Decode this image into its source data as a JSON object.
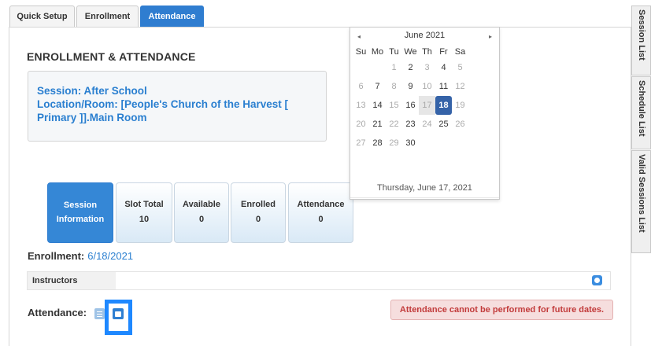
{
  "tabs": {
    "quick_setup": "Quick Setup",
    "enrollment": "Enrollment",
    "attendance": "Attendance"
  },
  "section_title": "ENROLLMENT & ATTENDANCE",
  "session": {
    "line1": "Session: After School",
    "line2": "Location/Room: [People's Church of the Harvest [",
    "line3": "Primary ]].Main Room"
  },
  "cards": {
    "session_info_line1": "Session",
    "session_info_line2": "Information",
    "slot_total_label": "Slot Total",
    "slot_total_value": "10",
    "available_label": "Available",
    "available_value": "0",
    "enrolled_label": "Enrolled",
    "enrolled_value": "0",
    "attendance_label": "Attendance",
    "attendance_value": "0"
  },
  "enrollment": {
    "label": "Enrollment:",
    "date": "6/18/2021"
  },
  "instructors_label": "Instructors",
  "attendance_label": "Attendance:",
  "warning": "Attendance cannot be performed for future dates.",
  "calendar": {
    "month": "June 2021",
    "prev": "◂",
    "next": "▸",
    "weekdays": [
      "Su",
      "Mo",
      "Tu",
      "We",
      "Th",
      "Fr",
      "Sa"
    ],
    "weeks": [
      [
        "",
        "",
        "1",
        "2",
        "3",
        "4",
        "5"
      ],
      [
        "6",
        "7",
        "8",
        "9",
        "10",
        "11",
        "12"
      ],
      [
        "13",
        "14",
        "15",
        "16",
        "17",
        "18",
        "19"
      ],
      [
        "20",
        "21",
        "22",
        "23",
        "24",
        "25",
        "26"
      ],
      [
        "27",
        "28",
        "29",
        "30",
        "",
        "",
        ""
      ]
    ],
    "selected_day": "18",
    "today_day": "17",
    "footer": "Thursday, June 17, 2021"
  },
  "side_tabs": {
    "session_list": "Session List",
    "schedule_list": "Schedule List",
    "valid_sessions_list": "Valid Sessions List"
  },
  "colors": {
    "accent": "#2f7dd0",
    "selected_day": "#3563a8",
    "warning_bg": "#f6dede",
    "warning_text": "#c23b3b"
  }
}
